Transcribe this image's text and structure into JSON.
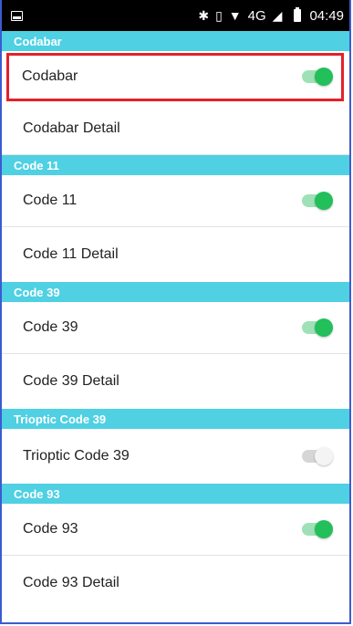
{
  "status_bar": {
    "time": "04:49",
    "network": "4G",
    "icons": [
      "notification-icon",
      "bluetooth-icon",
      "vibrate-icon",
      "wifi-icon",
      "signal-icon",
      "battery-icon"
    ]
  },
  "sections": [
    {
      "header": "Codabar",
      "rows": [
        {
          "label": "Codabar",
          "toggle": "on",
          "highlighted": true
        },
        {
          "label": "Codabar Detail"
        }
      ]
    },
    {
      "header": "Code 11",
      "rows": [
        {
          "label": "Code 11",
          "toggle": "on"
        },
        {
          "label": "Code 11 Detail"
        }
      ]
    },
    {
      "header": "Code 39",
      "rows": [
        {
          "label": "Code 39",
          "toggle": "on"
        },
        {
          "label": "Code 39 Detail"
        }
      ]
    },
    {
      "header": "Trioptic Code 39",
      "rows": [
        {
          "label": "Trioptic Code 39",
          "toggle": "off"
        }
      ]
    },
    {
      "header": "Code 93",
      "rows": [
        {
          "label": "Code 93",
          "toggle": "on"
        },
        {
          "label": "Code 93 Detail"
        }
      ]
    }
  ],
  "colors": {
    "section_header": "#4fd0e3",
    "toggle_on": "#22bf5b",
    "highlight": "#e4202a"
  }
}
